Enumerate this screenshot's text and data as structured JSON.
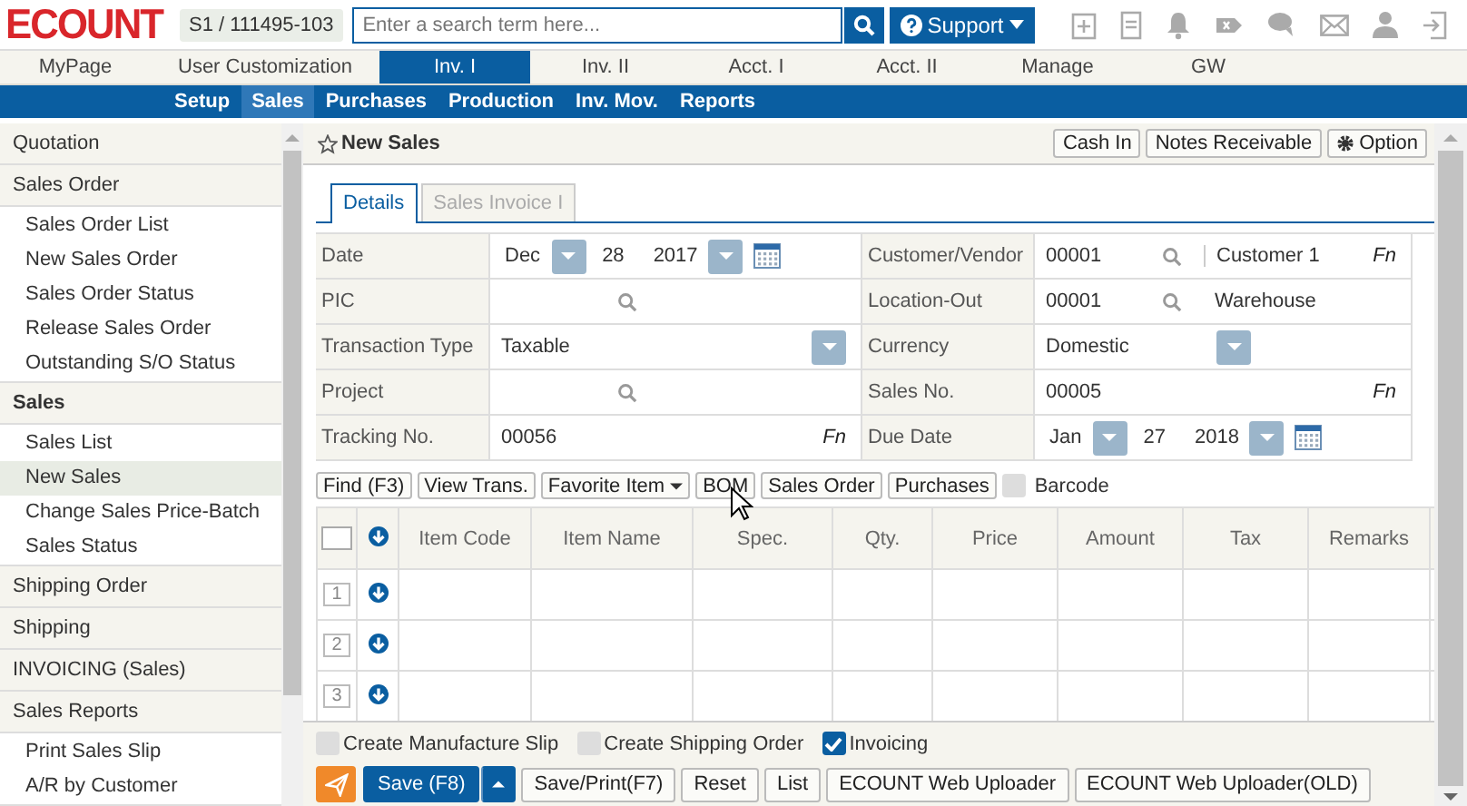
{
  "header": {
    "logo": "ECOUNT",
    "account": "S1 / 111495-103",
    "search": {
      "placeholder": "Enter a search term here..."
    },
    "support": "Support"
  },
  "nav": [
    {
      "label": "MyPage",
      "selected": false
    },
    {
      "label": "User Customization",
      "selected": false
    },
    {
      "label": "Inv. I",
      "selected": true
    },
    {
      "label": "Inv. II",
      "selected": false
    },
    {
      "label": "Acct. I",
      "selected": false
    },
    {
      "label": "Acct. II",
      "selected": false
    },
    {
      "label": "Manage",
      "selected": false
    },
    {
      "label": "GW",
      "selected": false
    }
  ],
  "subnav": [
    {
      "label": "Setup",
      "selected": false
    },
    {
      "label": "Sales",
      "selected": true
    },
    {
      "label": "Purchases",
      "selected": false
    },
    {
      "label": "Production",
      "selected": false
    },
    {
      "label": "Inv. Mov.",
      "selected": false
    },
    {
      "label": "Reports",
      "selected": false
    }
  ],
  "sidebar": {
    "groups": [
      {
        "label": "Quotation",
        "selected": false
      },
      {
        "label": "Sales Order",
        "selected": false,
        "items": [
          {
            "label": "Sales Order List",
            "selected": false
          },
          {
            "label": "New Sales Order",
            "selected": false
          },
          {
            "label": "Sales Order Status",
            "selected": false
          },
          {
            "label": "Release Sales Order",
            "selected": false
          },
          {
            "label": "Outstanding S/O Status",
            "selected": false
          }
        ]
      },
      {
        "label": "Sales",
        "selected": true,
        "items": [
          {
            "label": "Sales List",
            "selected": false
          },
          {
            "label": "New Sales",
            "selected": true
          },
          {
            "label": "Change Sales Price-Batch",
            "selected": false
          },
          {
            "label": "Sales Status",
            "selected": false
          }
        ]
      },
      {
        "label": "Shipping Order",
        "selected": false
      },
      {
        "label": "Shipping",
        "selected": false
      },
      {
        "label": "INVOICING (Sales)",
        "selected": false
      },
      {
        "label": "Sales Reports",
        "selected": false,
        "items": [
          {
            "label": "Print Sales Slip",
            "selected": false
          },
          {
            "label": "A/R by Customer",
            "selected": false
          }
        ]
      }
    ]
  },
  "page": {
    "title": "New Sales",
    "actions": [
      "Cash In",
      "Notes Receivable",
      "Option"
    ]
  },
  "tabs": [
    {
      "label": "Details",
      "selected": true
    },
    {
      "label": "Sales Invoice I",
      "selected": false
    }
  ],
  "fields": [
    {
      "label": "Date",
      "kind": "date",
      "month": "Dec",
      "day": "28",
      "year": "2017"
    },
    {
      "label": "Customer/Vendor",
      "kind": "lookup",
      "code": "00001",
      "name": "Customer 1",
      "fn": "Fn"
    },
    {
      "label": "PIC",
      "kind": "lookup"
    },
    {
      "label": "Location-Out",
      "kind": "lookup",
      "code": "00001",
      "name": "Warehouse"
    },
    {
      "label": "Transaction Type",
      "kind": "select",
      "value": "Taxable"
    },
    {
      "label": "Currency",
      "kind": "select",
      "value": "Domestic"
    },
    {
      "label": "Project",
      "kind": "lookup"
    },
    {
      "label": "Sales No.",
      "kind": "text",
      "value": "00005",
      "fn": "Fn"
    },
    {
      "label": "Tracking No.",
      "kind": "text",
      "value": "00056",
      "fn": "Fn"
    },
    {
      "label": "Due Date",
      "kind": "date",
      "month": "Jan",
      "day": "27",
      "year": "2018"
    }
  ],
  "toolbar": {
    "buttons": [
      {
        "label": "Find (F3)",
        "dropdown": false
      },
      {
        "label": "View Trans.",
        "dropdown": false
      },
      {
        "label": "Favorite Item",
        "dropdown": true
      },
      {
        "label": "BOM",
        "dropdown": false
      },
      {
        "label": "Sales Order",
        "dropdown": false
      },
      {
        "label": "Purchases",
        "dropdown": false
      }
    ],
    "barcode": {
      "label": "Barcode",
      "checked": false
    }
  },
  "table": {
    "select_all": {
      "checked": false
    },
    "columns": [
      "Item Code",
      "Item Name",
      "Spec.",
      "Qty.",
      "Price",
      "Amount",
      "Tax",
      "Remarks"
    ],
    "rows": [
      "1",
      "2",
      "3"
    ]
  },
  "options": [
    {
      "label": "Create Manufacture Slip",
      "checked": false
    },
    {
      "label": "Create Shipping Order",
      "checked": false
    },
    {
      "label": "Invoicing",
      "checked": true
    }
  ],
  "footer_buttons": [
    {
      "label": "Save (F8)",
      "kind": "primary"
    },
    {
      "label": "Save/Print(F7)",
      "kind": "plain"
    },
    {
      "label": "Reset",
      "kind": "plain"
    },
    {
      "label": "List",
      "kind": "plain"
    },
    {
      "label": "ECOUNT Web Uploader",
      "kind": "plain"
    },
    {
      "label": "ECOUNT Web Uploader(OLD)",
      "kind": "plain"
    }
  ]
}
